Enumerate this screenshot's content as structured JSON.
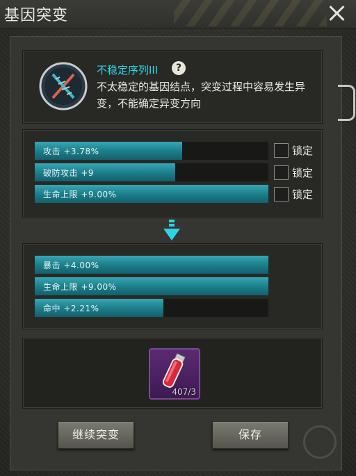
{
  "window": {
    "title": "基因突变"
  },
  "gene": {
    "name": "不稳定序列III",
    "description": "不太稳定的基因结点，突变过程中容易发生异变，不能确定异变方向",
    "help_symbol": "?"
  },
  "current_attributes": [
    {
      "label": "攻击 +3.78%",
      "fill": 0.63,
      "lock_label": "锁定"
    },
    {
      "label": "破防攻击 +9",
      "fill": 0.6,
      "lock_label": "锁定"
    },
    {
      "label": "生命上限 +9.00%",
      "fill": 1.0,
      "lock_label": "锁定"
    }
  ],
  "new_attributes": [
    {
      "label": "暴击 +4.00%",
      "fill": 1.0
    },
    {
      "label": "生命上限 +9.00%",
      "fill": 1.0
    },
    {
      "label": "命中 +2.21%",
      "fill": 0.55
    }
  ],
  "item": {
    "icon": "red-vial-icon",
    "count": "407/3"
  },
  "buttons": {
    "continue_label": "继续突变",
    "save_label": "保存"
  },
  "colors": {
    "accent": "#2fd3e6",
    "bar_fill": "#1b7c89",
    "item_slot": "#5a2a72"
  }
}
